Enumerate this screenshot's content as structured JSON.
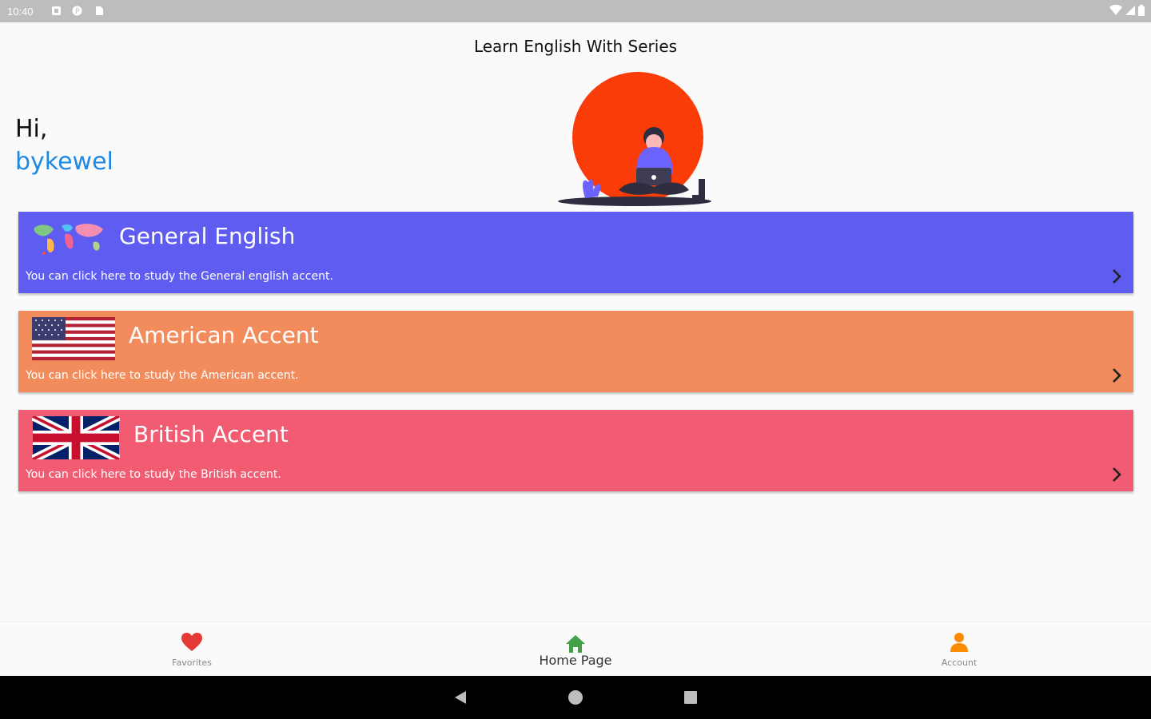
{
  "status_bar": {
    "time": "10:40",
    "icons": [
      "notification-icon",
      "app-icon",
      "sd-card-icon"
    ],
    "right_icons": [
      "wifi-icon",
      "signal-icon",
      "battery-icon"
    ]
  },
  "app": {
    "title": "Learn English With Series"
  },
  "greeting": {
    "hi": "Hi,",
    "username": "bykewel",
    "username_color": "#1e88e5"
  },
  "cards": [
    {
      "title": "General English",
      "description": "You can click here to study the General english accent.",
      "color": "#5f5cf2",
      "icon": "world-map-icon"
    },
    {
      "title": "American Accent",
      "description": "You can click here to study the American accent.",
      "color": "#f28c5c",
      "icon": "us-flag-icon"
    },
    {
      "title": "British Accent",
      "description": "You can click here to study the British accent.",
      "color": "#f15c72",
      "icon": "uk-flag-icon"
    }
  ],
  "bottom_nav": {
    "items": [
      {
        "label": "Favorites",
        "icon": "heart-icon",
        "color": "#e53935"
      },
      {
        "label": "Home Page",
        "icon": "home-icon",
        "color": "#43a047",
        "active": true
      },
      {
        "label": "Account",
        "icon": "person-icon",
        "color": "#fb8c00"
      }
    ]
  },
  "system_nav": [
    "back-icon",
    "home-circle-icon",
    "recents-icon"
  ]
}
